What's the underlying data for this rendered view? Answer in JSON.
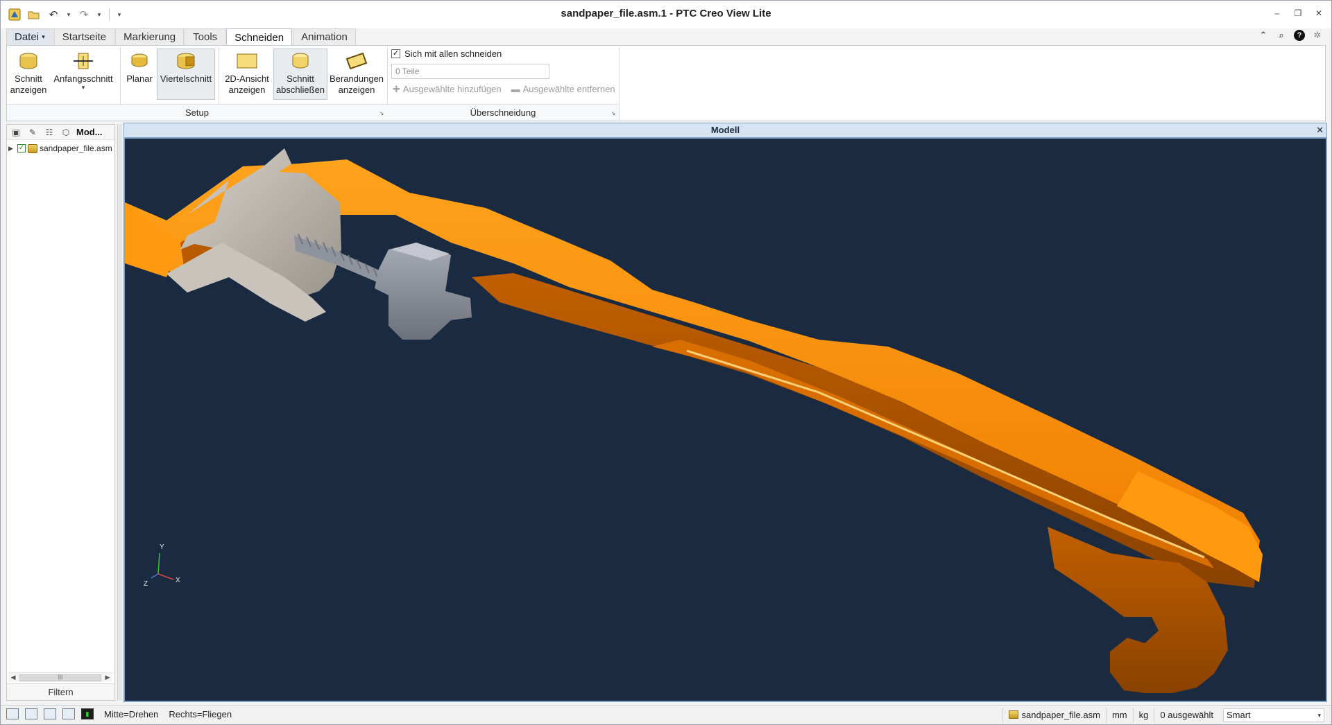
{
  "window": {
    "title": "sandpaper_file.asm.1 - PTC Creo View Lite"
  },
  "quick_access": {
    "icons": [
      "app-icon",
      "open-icon",
      "undo-icon",
      "redo-icon",
      "customize-icon"
    ]
  },
  "ribbon_tabs": [
    {
      "label": "Datei",
      "active": false
    },
    {
      "label": "Startseite",
      "active": false
    },
    {
      "label": "Markierung",
      "active": false
    },
    {
      "label": "Tools",
      "active": false
    },
    {
      "label": "Schneiden",
      "active": true
    },
    {
      "label": "Animation",
      "active": false
    }
  ],
  "ribbon": {
    "setup": {
      "label": "Setup",
      "buttons": [
        {
          "line1": "Schnitt",
          "line2": "anzeigen",
          "pressed": false
        },
        {
          "line1": "Anfangsschnitt",
          "line2": "",
          "pressed": false
        },
        {
          "line1": "Planar",
          "line2": "",
          "pressed": false
        },
        {
          "line1": "Viertelschnitt",
          "line2": "",
          "pressed": true
        },
        {
          "line1": "2D-Ansicht",
          "line2": "anzeigen",
          "pressed": false
        },
        {
          "line1": "Schnitt",
          "line2": "abschließen",
          "pressed": true
        },
        {
          "line1": "Berandungen",
          "line2": "anzeigen",
          "pressed": false
        }
      ]
    },
    "intersection": {
      "label": "Überschneidung",
      "checkbox_label": "Sich mit allen schneiden",
      "checkbox_checked": true,
      "parts_placeholder": "0 Teile",
      "add_selected": "Ausgewählte hinzufügen",
      "remove_selected": "Ausgewählte entfernen"
    }
  },
  "model_tree": {
    "header": "Mod...",
    "root_item": "sandpaper_file.asm",
    "filter_label": "Filtern"
  },
  "viewport": {
    "title": "Modell",
    "triad": {
      "y": "Y",
      "x": "X",
      "z": "Z"
    },
    "background_color": "#1a2b41",
    "part_color": "#ff8c00",
    "clamp_color": "#b8b2ab",
    "screw_color": "#8b8f99"
  },
  "statusbar": {
    "hint_middle": "Mitte=Drehen",
    "hint_right": "Rechts=Fliegen",
    "file": "sandpaper_file.asm",
    "length_unit": "mm",
    "mass_unit": "kg",
    "selected": "0 ausgewählt",
    "filter_mode": "Smart"
  }
}
